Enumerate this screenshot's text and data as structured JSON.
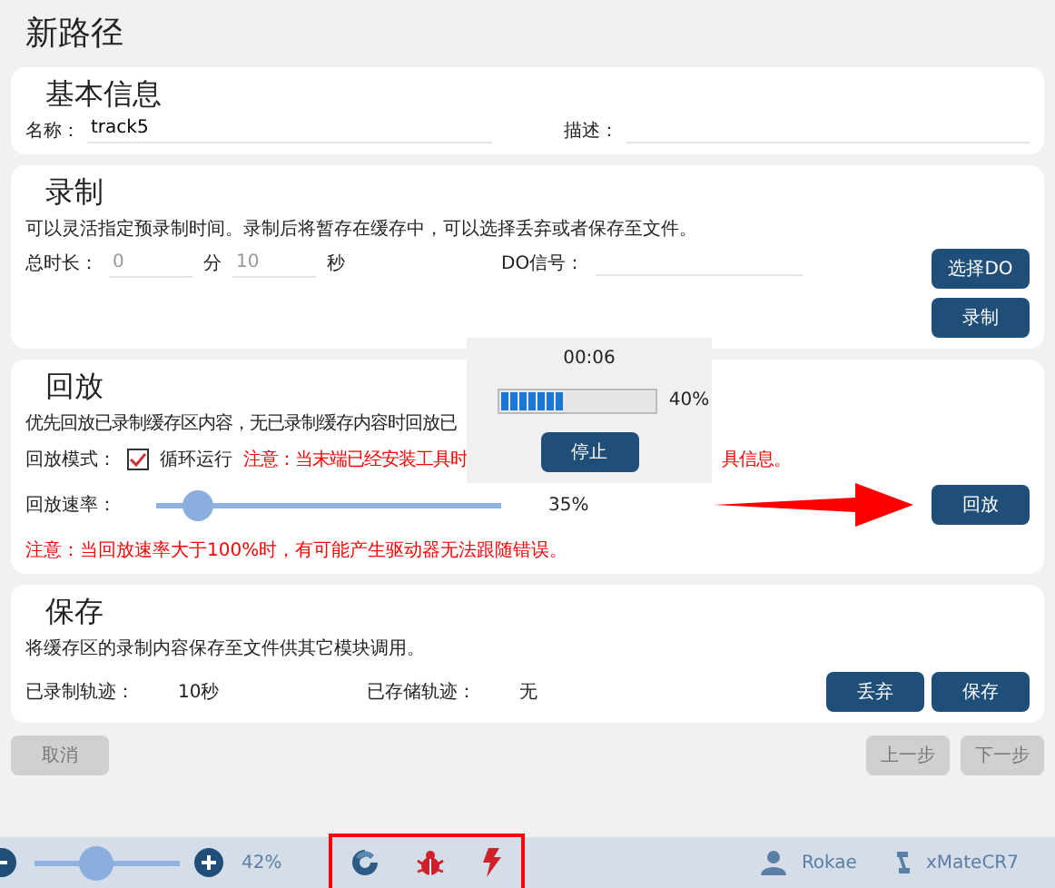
{
  "title": "新路径",
  "basic": {
    "heading": "基本信息",
    "fields": [
      {
        "label": "名称：",
        "value": "track5"
      },
      {
        "label": "描述："
      }
    ]
  },
  "record": {
    "heading": "录制",
    "description": "可以灵活指定预录制时间。录制后将暂存在缓存中，可以选择丢弃或者保存至文件。",
    "duration_label": "总时长：",
    "minutes": {
      "placeholder": "0",
      "unit": "分"
    },
    "seconds": {
      "placeholder": "10",
      "unit": "秒"
    },
    "do_label": "DO信号：",
    "buttons": [
      "选择DO",
      "录制"
    ]
  },
  "playback": {
    "heading": "回放",
    "description": "优先回放已录制缓存区内容，无已录制缓存内容时回放已",
    "mode_label": "回放模式：",
    "loop": {
      "label": "循环运行",
      "checked": true
    },
    "notice_parts": [
      "注意：当末端已经安装工具时",
      "具信息。"
    ],
    "speed_label": "回放速率：",
    "speed": {
      "level": 0.12,
      "reading": "35%"
    },
    "warning": "注意：当回放速率大于100%时，有可能产生驱动器无法跟随错误。",
    "button": "回放"
  },
  "popup": {
    "time": "00:06",
    "level": 0.4,
    "reading": "40%",
    "button": "停止"
  },
  "save": {
    "heading": "保存",
    "description": "将缓存区的录制内容保存至文件供其它模块调用。",
    "recorded_label": "已录制轨迹：",
    "recorded_value": "10秒",
    "stored_label": "已存储轨迹：",
    "stored_value": "无",
    "buttons": [
      "丢弃",
      "保存"
    ]
  },
  "footer": [
    {
      "label": "取消",
      "disabled": true
    },
    {
      "label": "上一步",
      "disabled": true
    },
    {
      "label": "下一步",
      "disabled": true
    }
  ],
  "status_bar": {
    "zoom": {
      "level": 0.43,
      "reading": "42%"
    },
    "user": "Rokae",
    "robot": "xMateCR7"
  }
}
